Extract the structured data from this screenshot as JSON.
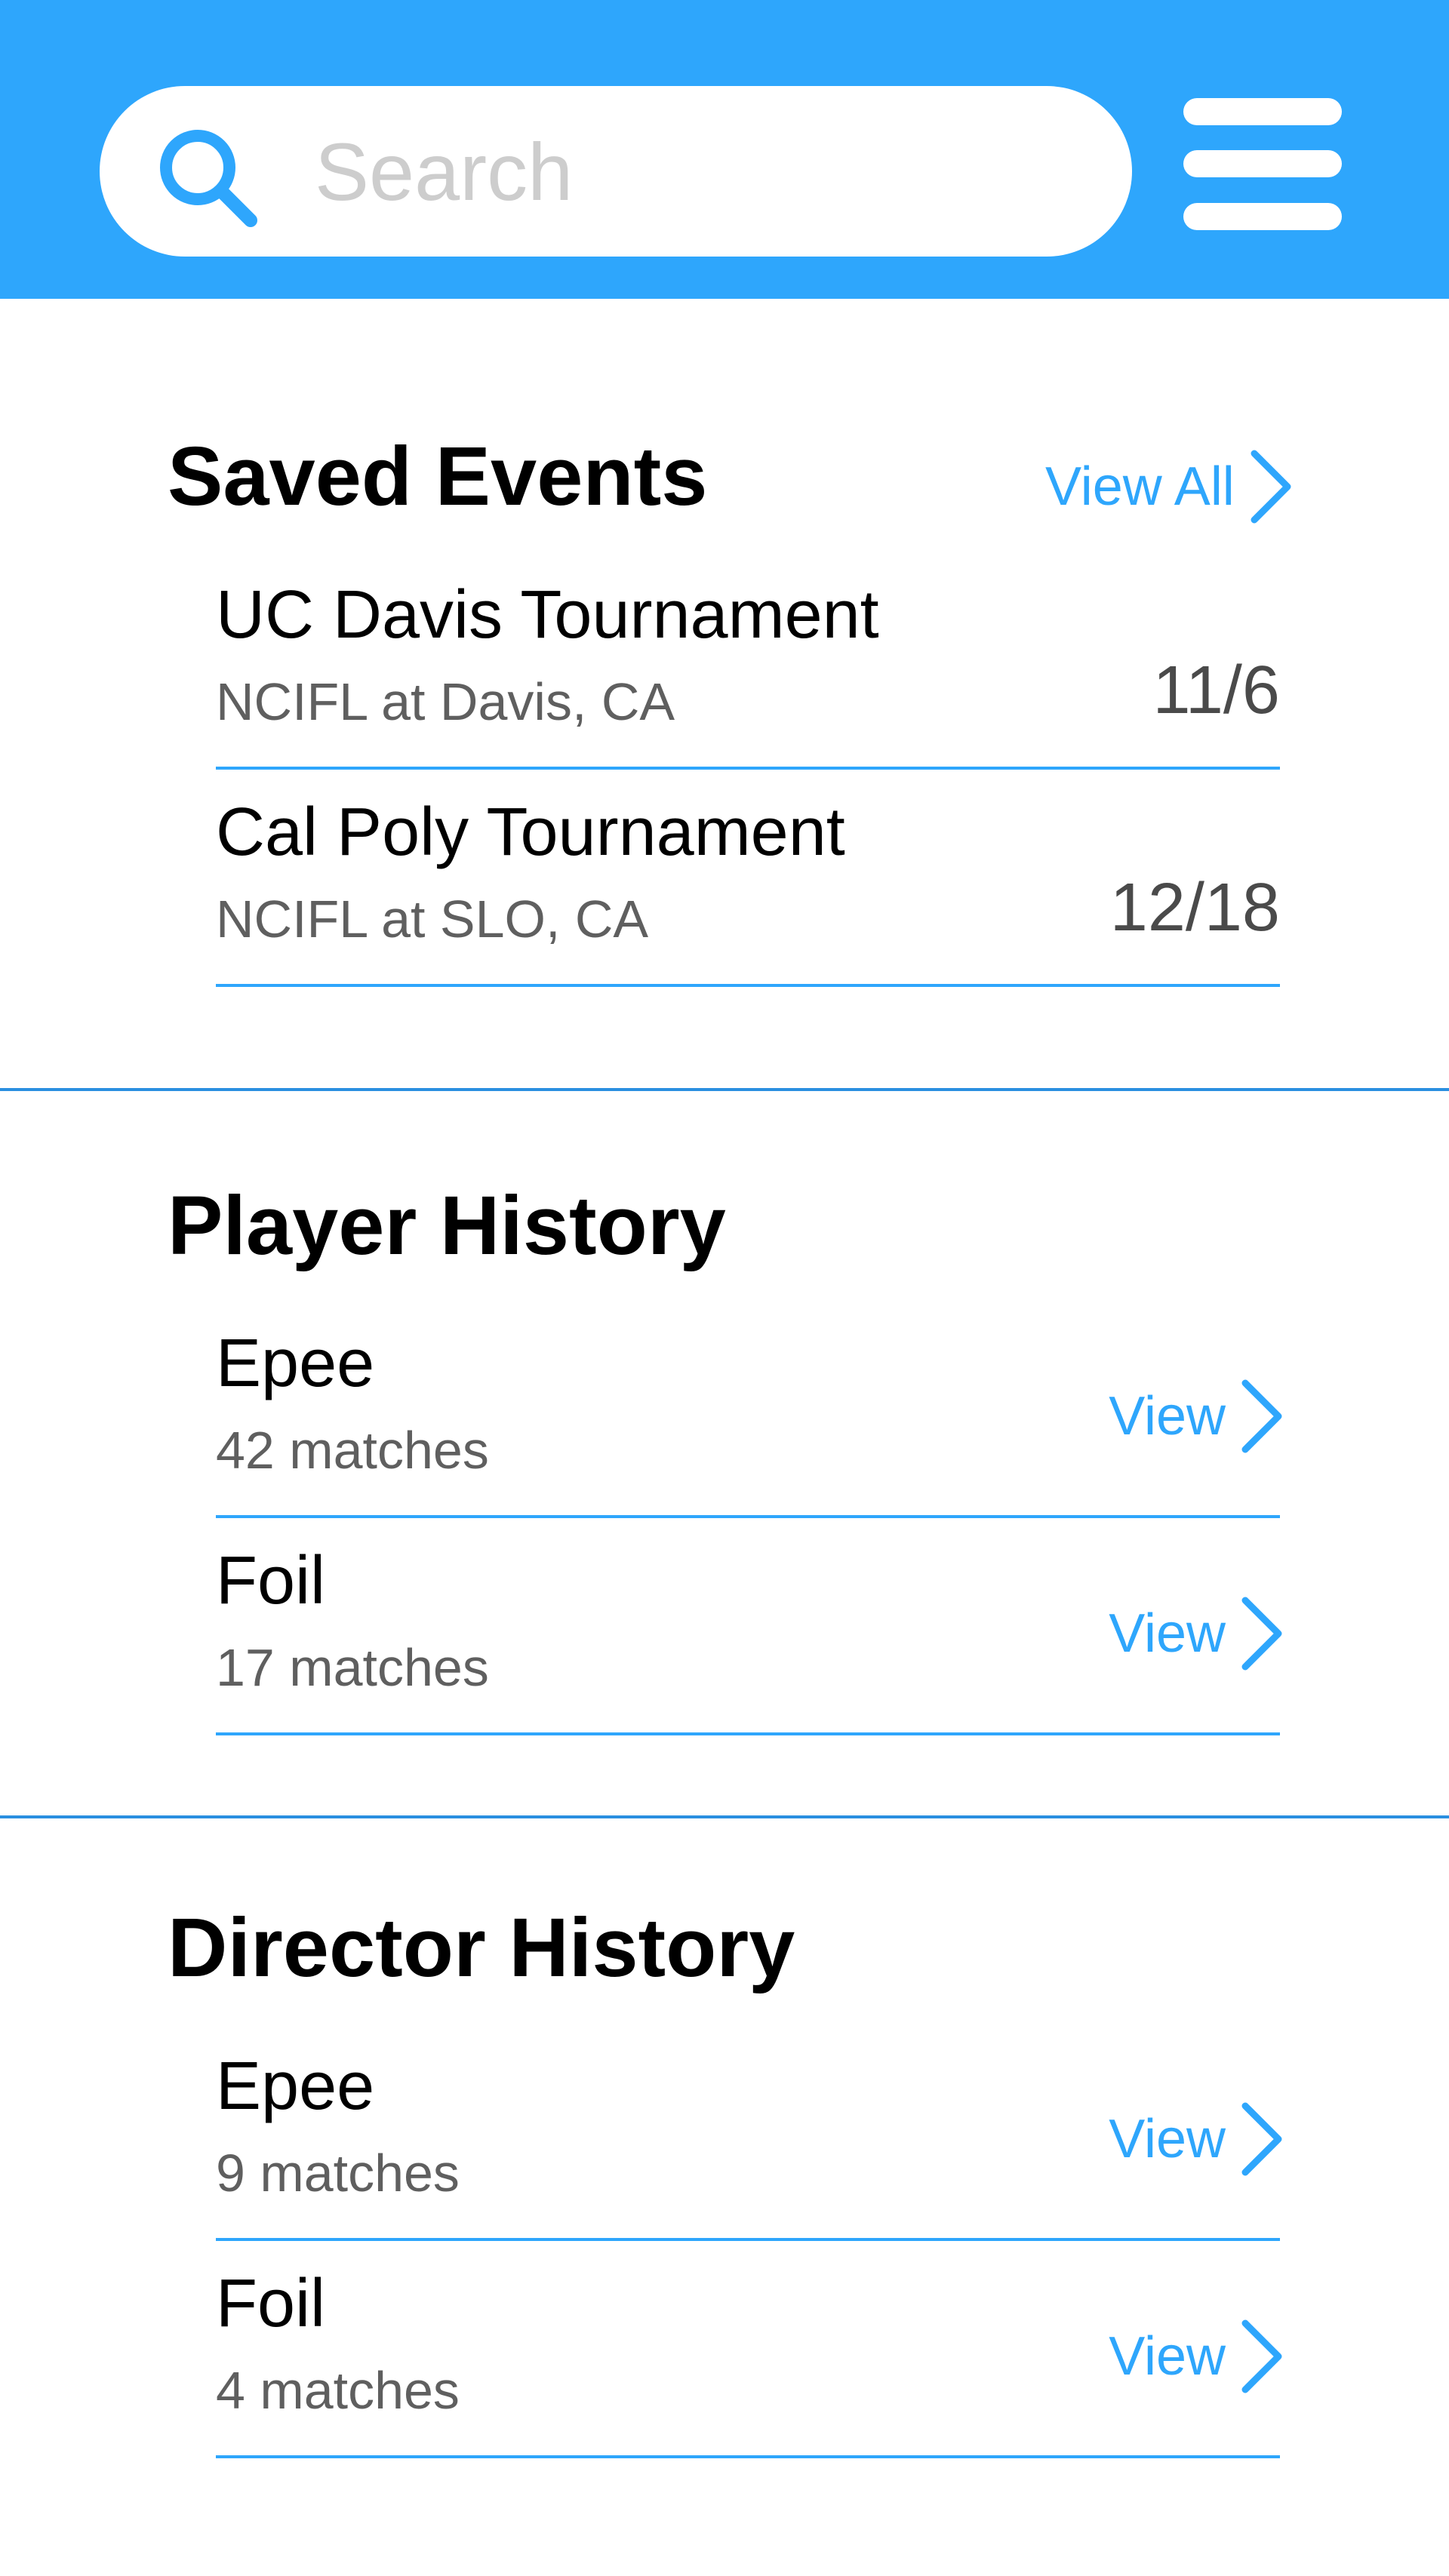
{
  "colors": {
    "header_bg": "#2ea6fc",
    "accent": "#2ea6fc",
    "title_text": "#000000",
    "secondary_text": "#5f5f5f"
  },
  "header": {
    "search": {
      "placeholder": "Search",
      "value": "",
      "icon": "search-icon"
    },
    "menu_icon": "hamburger-menu-icon"
  },
  "saved_events": {
    "title": "Saved Events",
    "view_all_label": "View All",
    "events": [
      {
        "name": "UC Davis Tournament",
        "location": "NCIFL at Davis, CA",
        "date": "11/6"
      },
      {
        "name": "Cal Poly Tournament",
        "location": "NCIFL at SLO, CA",
        "date": "12/18"
      }
    ]
  },
  "player_history": {
    "title": "Player History",
    "items": [
      {
        "weapon": "Epee",
        "matches": "42 matches",
        "link_label": "View"
      },
      {
        "weapon": "Foil",
        "matches": "17 matches",
        "link_label": "View"
      }
    ]
  },
  "director_history": {
    "title": "Director History",
    "items": [
      {
        "weapon": "Epee",
        "matches": "9 matches",
        "link_label": "View"
      },
      {
        "weapon": "Foil",
        "matches": "4 matches",
        "link_label": "View"
      }
    ]
  }
}
